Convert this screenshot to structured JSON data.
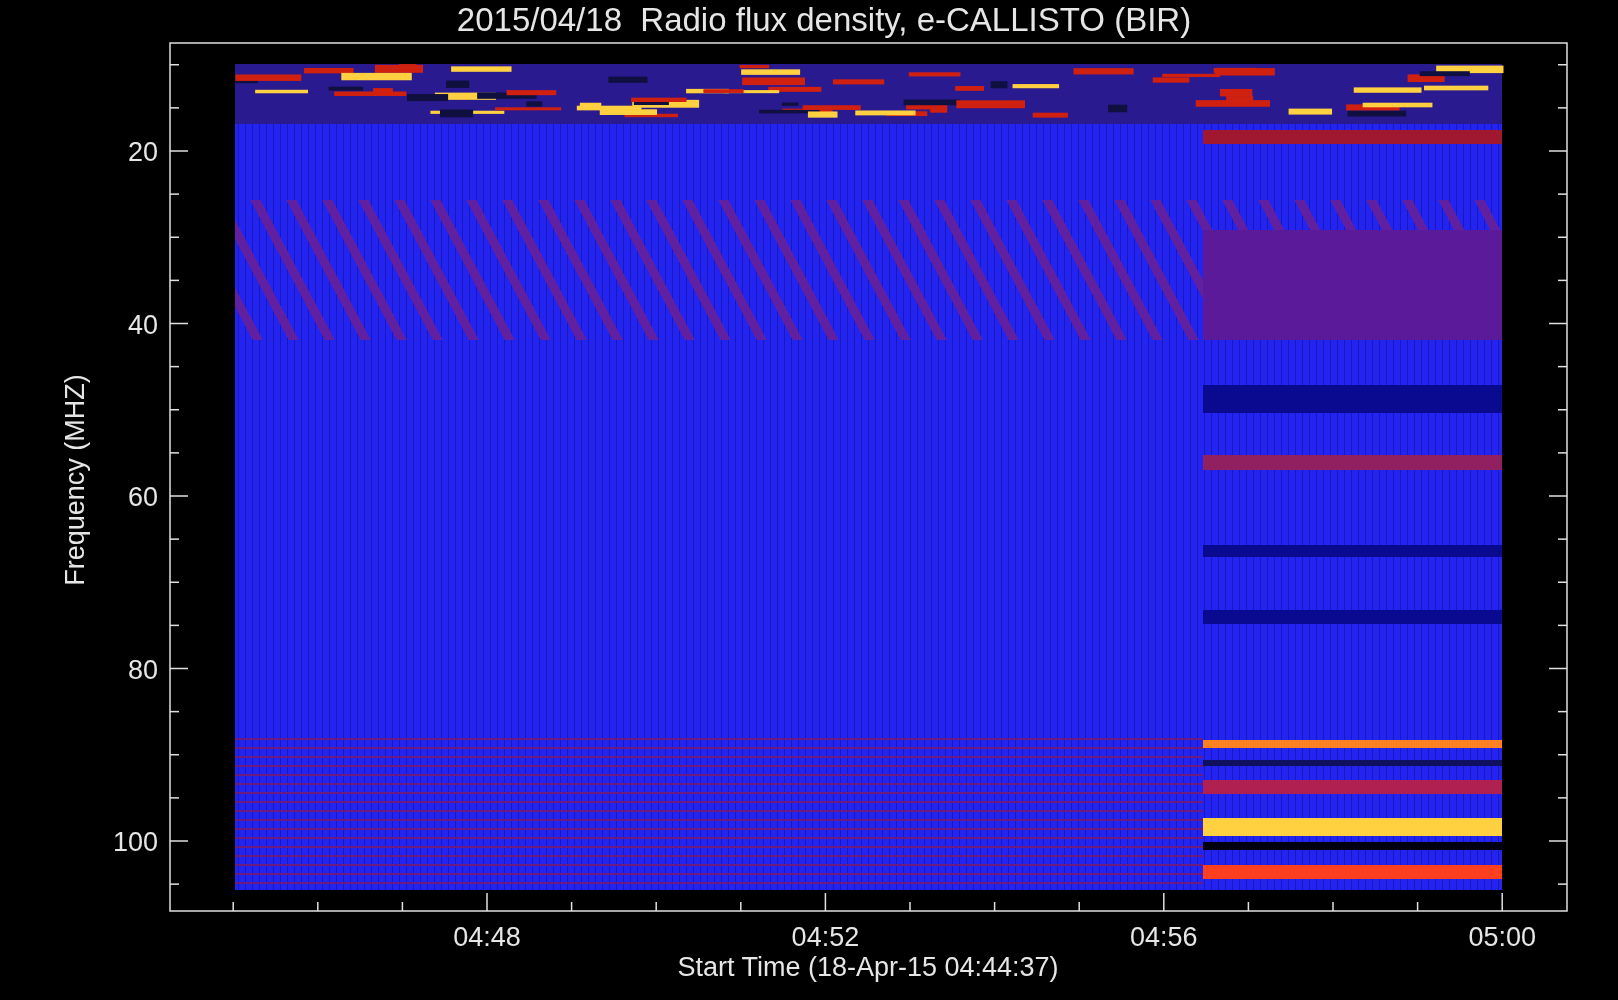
{
  "title": "2015/04/18  Radio flux density, e-CALLISTO (BIR)",
  "y_axis": {
    "label": "Frequency (MHZ)",
    "ticks": [
      "20",
      "40",
      "60",
      "80",
      "100"
    ]
  },
  "x_axis": {
    "label": "Start Time (18-Apr-15 04:44:37)",
    "ticks": [
      "04:48",
      "04:52",
      "04:56",
      "05:00"
    ]
  }
}
